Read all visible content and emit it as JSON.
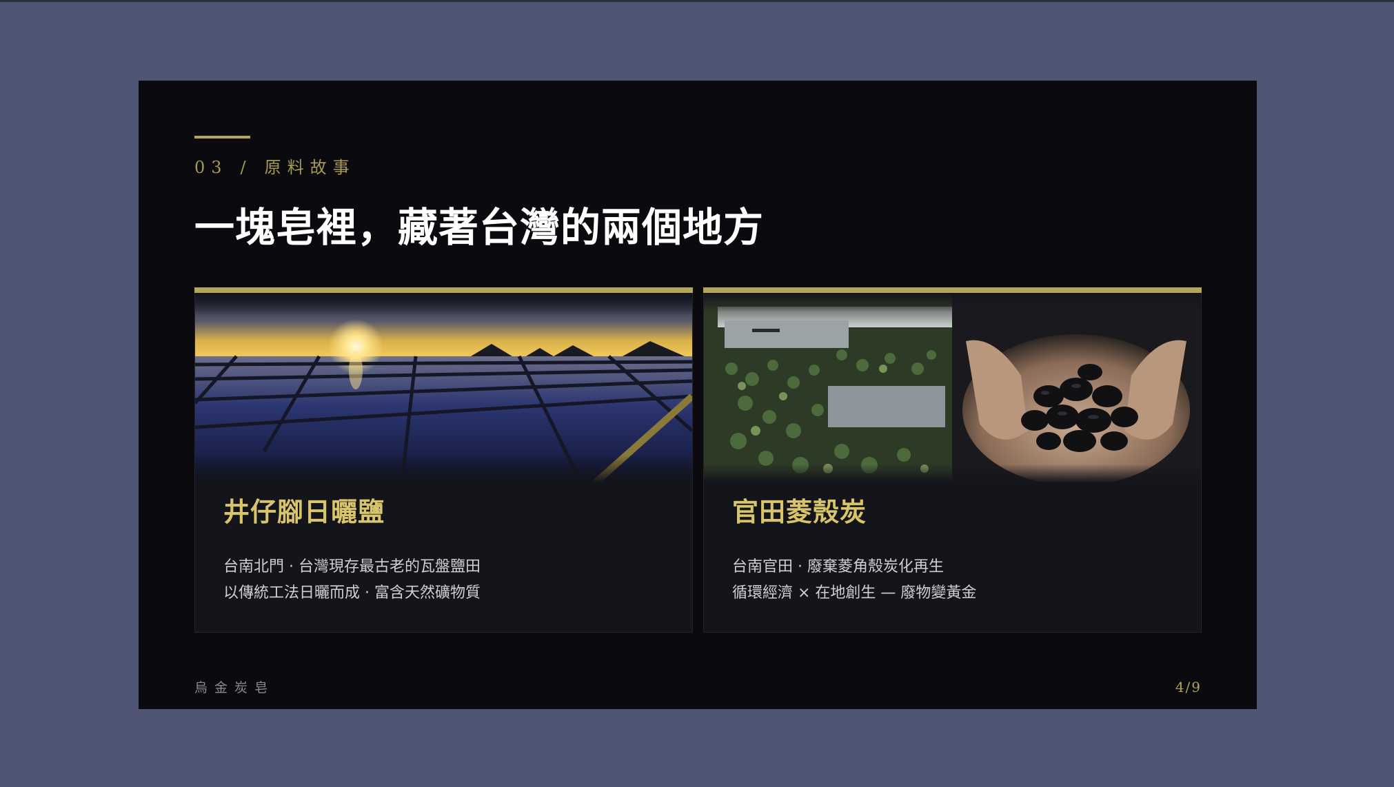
{
  "slide": {
    "kicker_number": "03",
    "kicker_separator": "/",
    "kicker_label": "原料故事",
    "title": "一塊皂裡，藏著台灣的兩個地方",
    "brand": "烏金炭皂",
    "page_indicator": "4/9",
    "accent_color": "#b5a556",
    "card_title_color": "#d8c46a"
  },
  "cards": [
    {
      "title": "井仔腳日曬鹽",
      "line1": "台南北門 · 台灣現存最古老的瓦盤鹽田",
      "line2": "以傳統工法日曬而成 · 富含天然礦物質",
      "photo": "salt-field-sunset-image"
    },
    {
      "title": "官田菱殼炭",
      "line1": "台南官田 · 廢棄菱角殼炭化再生",
      "line2": "循環經濟 × 在地創生 — 廢物變黃金",
      "photo": "water-caltrop-and-charcoal-image"
    }
  ]
}
